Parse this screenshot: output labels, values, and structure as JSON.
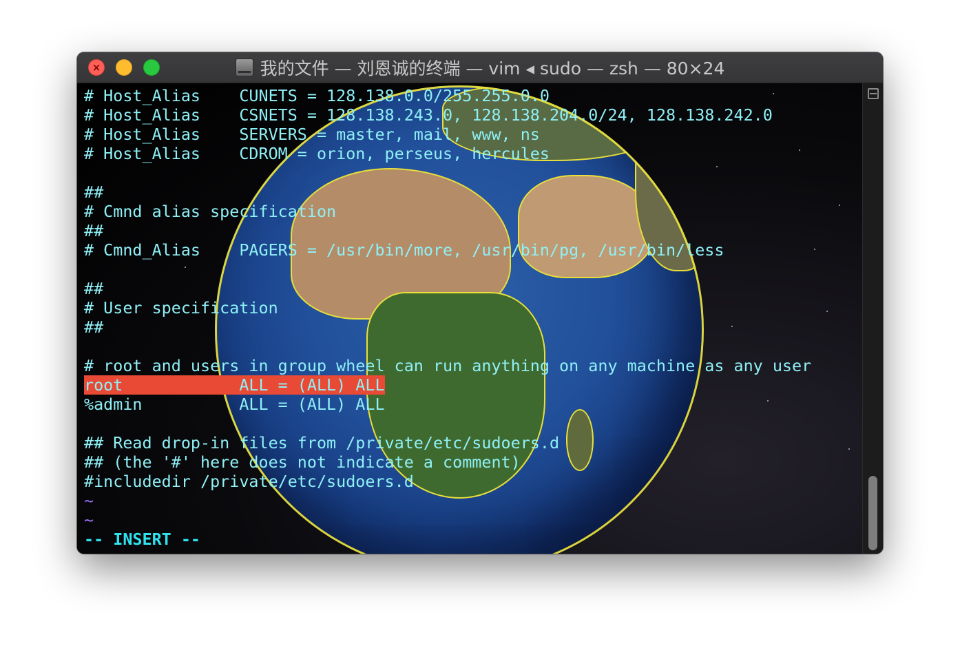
{
  "window": {
    "title": "我的文件 — 刘恩诚的终端 — vim ◂ sudo — zsh — 80×24",
    "close_glyph": "×"
  },
  "terminal": {
    "lines": [
      "# Host_Alias    CUNETS = 128.138.0.0/255.255.0.0",
      "# Host_Alias    CSNETS = 128.138.243.0, 128.138.204.0/24, 128.138.242.0",
      "# Host_Alias    SERVERS = master, mail, www, ns",
      "# Host_Alias    CDROM = orion, perseus, hercules",
      "",
      "##",
      "# Cmnd alias specification",
      "##",
      "# Cmnd_Alias    PAGERS = /usr/bin/more, /usr/bin/pg, /usr/bin/less",
      "",
      "##",
      "# User specification",
      "##",
      "",
      "# root and users in group wheel can run anything on any machine as any user",
      "root            ALL = (ALL) ALL",
      "%admin          ALL = (ALL) ALL",
      "",
      "## Read drop-in files from /private/etc/sudoers.d",
      "## (the '#' here does not indicate a comment)",
      "#includedir /private/etc/sudoers.d",
      "~",
      "~",
      "-- INSERT --"
    ]
  },
  "colors": {
    "text": "#8ff0f6",
    "highlight": "#e84a35",
    "tilde": "#9b72ff",
    "mode": "#2fe3f0"
  }
}
